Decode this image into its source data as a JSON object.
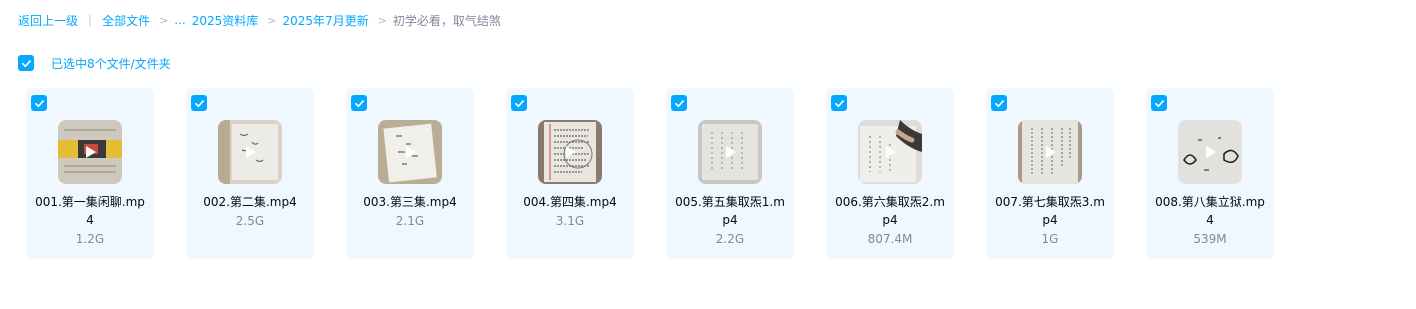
{
  "breadcrumb": {
    "back": "返回上一级",
    "all_files": "全部文件",
    "ellipsis": "...",
    "folder1": "2025资料库",
    "folder2": "2025年7月更新",
    "current": "初学必看，取气结煞"
  },
  "selection": {
    "label": "已选中8个文件/文件夹",
    "all_checked": true
  },
  "colors": {
    "accent": "#06a7ff",
    "card_bg": "#eef8fe",
    "text_main": "#03081a",
    "text_muted": "#818999"
  },
  "files": [
    {
      "name": "001.第一集闲聊.mp4",
      "size": "1.2G",
      "checked": true,
      "icon": "video-thumbnail"
    },
    {
      "name": "002.第二集.mp4",
      "size": "2.5G",
      "checked": true,
      "icon": "video-thumbnail"
    },
    {
      "name": "003.第三集.mp4",
      "size": "2.1G",
      "checked": true,
      "icon": "video-thumbnail"
    },
    {
      "name": "004.第四集.mp4",
      "size": "3.1G",
      "checked": true,
      "icon": "video-thumbnail"
    },
    {
      "name": "005.第五集取炁1.mp4",
      "size": "2.2G",
      "checked": true,
      "icon": "video-thumbnail"
    },
    {
      "name": "006.第六集取炁2.mp4",
      "size": "807.4M",
      "checked": true,
      "icon": "video-thumbnail"
    },
    {
      "name": "007.第七集取炁3.mp4",
      "size": "1G",
      "checked": true,
      "icon": "video-thumbnail"
    },
    {
      "name": "008.第八集立狱.mp4",
      "size": "539M",
      "checked": true,
      "icon": "video-thumbnail"
    }
  ]
}
